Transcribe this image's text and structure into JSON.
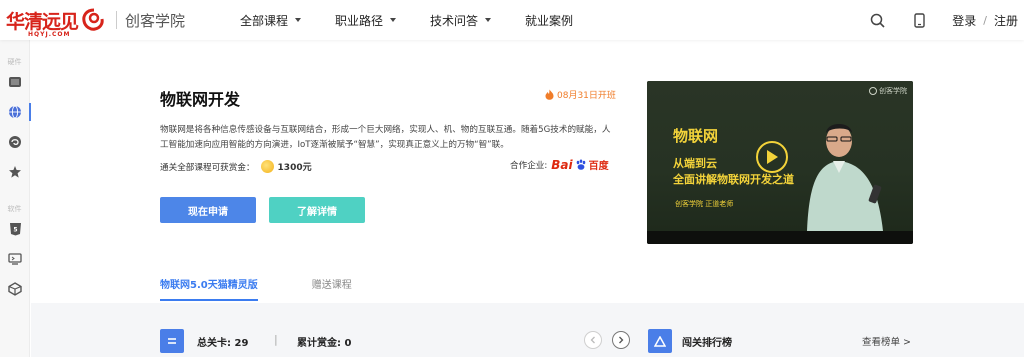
{
  "header": {
    "logo_cn": "华清远见",
    "logo_sub": "HQYJ.COM",
    "school_name": "创客学院",
    "nav": [
      {
        "label": "全部课程",
        "dropdown": true
      },
      {
        "label": "职业路径",
        "dropdown": true
      },
      {
        "label": "技术问答",
        "dropdown": true
      },
      {
        "label": "就业案例",
        "dropdown": false
      }
    ],
    "login": "登录",
    "separator": "/",
    "register": "注册"
  },
  "sidebar": {
    "group1_label": "硬件",
    "group1_icons": [
      "chip-icon",
      "globe-icon",
      "swirl-icon",
      "star-icon"
    ],
    "group2_label": "软件",
    "group2_icons": [
      "html5-icon",
      "terminal-icon",
      "unity-icon"
    ]
  },
  "course": {
    "title": "物联网开发",
    "open_date": "08月31日开班",
    "description": "物联网是将各种信息传感设备与互联网结合，形成一个巨大网络，实现人、机、物的互联互通。随着5G技术的赋能，人工智能加速向应用智能的方向演进，IoT逐渐被赋予“智慧”，实现真正意义上的万物“智”联。",
    "reward_label": "通关全部课程可获赏金：",
    "reward_amount": "1300元",
    "partner_label": "合作企业:",
    "partner_bai": "Bai",
    "partner_du": "百度",
    "apply_button": "现在申请",
    "detail_button": "了解详情"
  },
  "video": {
    "brand": "创客学院",
    "title": "物联网",
    "subtitle1": "从端到云",
    "subtitle2": "全面讲解物联网开发之道",
    "teacher": "创客学院  正道老师"
  },
  "tabs": [
    {
      "label": "物联网5.0天猫精灵版",
      "active": true
    },
    {
      "label": "赠送课程",
      "active": false
    }
  ],
  "stats": {
    "total_cards_label": "总关卡:",
    "total_cards_value": "29",
    "separator": "|",
    "bounty_label": "累计赏金:",
    "bounty_value": "0",
    "rank_title": "闯关排行榜",
    "rank_link": "查看榜单 >"
  },
  "colors": {
    "brand_red": "#d7241b",
    "primary_blue": "#4d86e8",
    "teal": "#4fd1c3",
    "orange": "#f07d2a",
    "video_yellow": "#f3d33a"
  }
}
